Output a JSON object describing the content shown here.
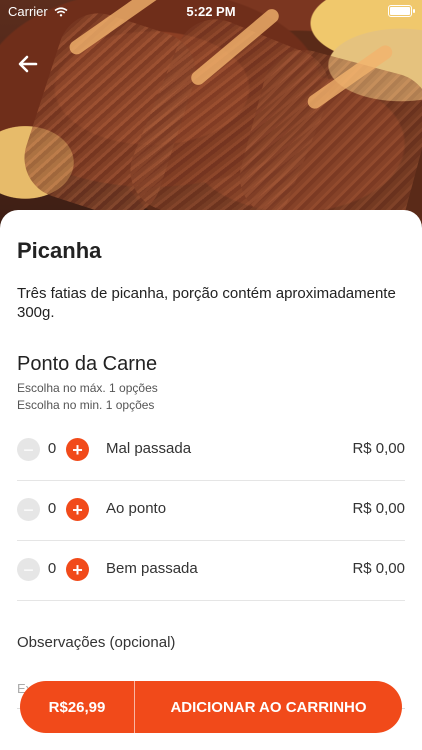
{
  "status_bar": {
    "carrier": "Carrier",
    "time": "5:22 PM"
  },
  "product": {
    "name": "Picanha",
    "description": "Três fatias de picanha, porção contém aproximadamente 300g."
  },
  "options_section": {
    "title": "Ponto da Carne",
    "max_rule": "Escolha no máx. 1 opções",
    "min_rule": "Escolha no min. 1 opções",
    "items": [
      {
        "label": "Mal passada",
        "quantity": "0",
        "price": "R$ 0,00"
      },
      {
        "label": "Ao ponto",
        "quantity": "0",
        "price": "R$ 0,00"
      },
      {
        "label": "Bem passada",
        "quantity": "0",
        "price": "R$ 0,00"
      }
    ]
  },
  "notes": {
    "label": "Observações (opcional)",
    "placeholder": "Ex: sem picles",
    "value": ""
  },
  "cart_button": {
    "price": "R$26,99",
    "label": "ADICIONAR AO CARRINHO"
  },
  "colors": {
    "accent": "#f14a1a",
    "disabled": "#e6e6e6"
  },
  "icons": {
    "back": "arrow-left-icon",
    "plus": "plus-icon",
    "minus": "minus-icon"
  }
}
